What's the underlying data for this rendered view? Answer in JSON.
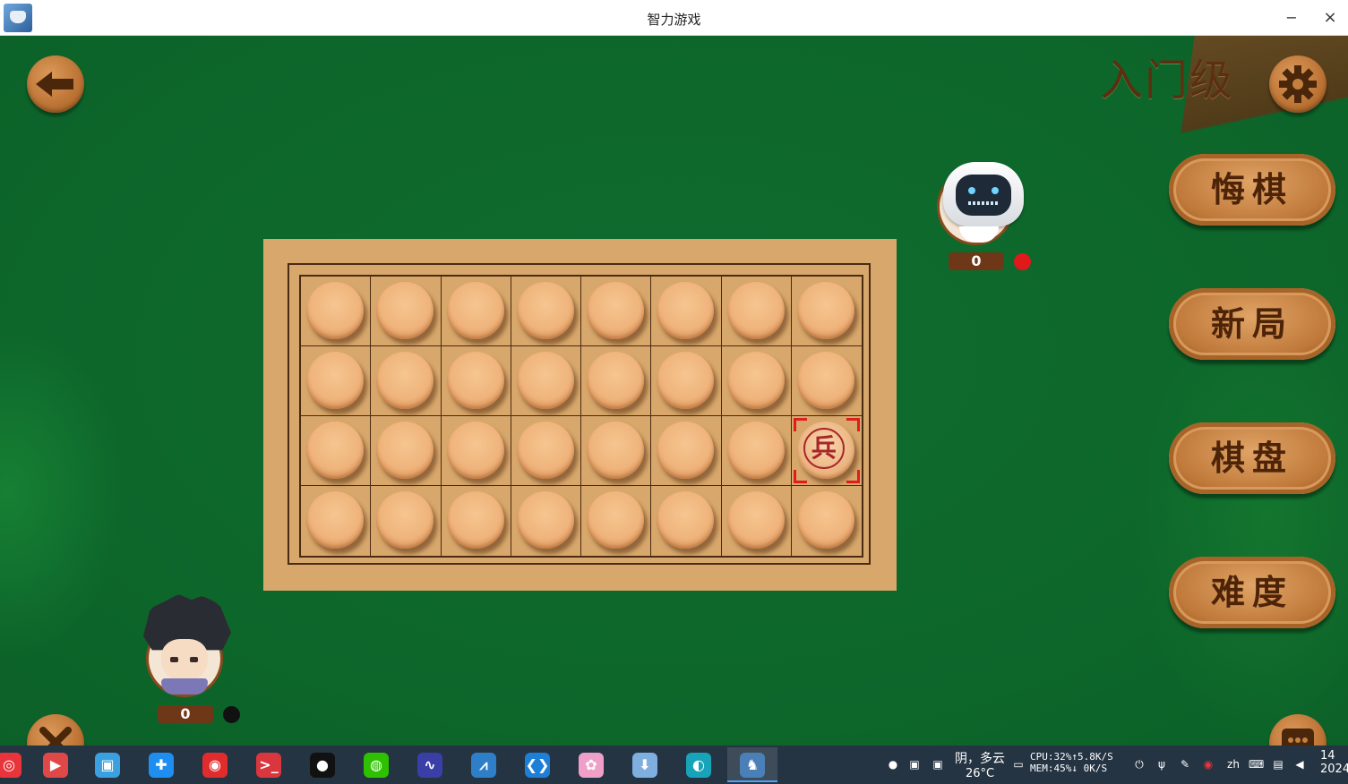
{
  "window": {
    "title": "智力游戏",
    "minimize_glyph": "−",
    "close_glyph": "×"
  },
  "game": {
    "level_label": "入门级",
    "back_icon": "arrow-left-icon",
    "settings_icon": "gear-icon",
    "close_icon": "close-icon",
    "chat_icon": "chat-icon",
    "side_buttons": [
      {
        "name": "undo-button",
        "label": "悔棋"
      },
      {
        "name": "new-game-button",
        "label": "新局"
      },
      {
        "name": "board-button",
        "label": "棋盘"
      },
      {
        "name": "difficulty-button",
        "label": "难度"
      }
    ],
    "opponent": {
      "role": "robot",
      "score": "0",
      "turn_color": "#e0191b"
    },
    "player": {
      "role": "boy",
      "score": "0",
      "turn_color": "#111111"
    },
    "board": {
      "rows": 4,
      "cols": 8,
      "revealed": [
        {
          "row": 2,
          "col": 7,
          "char": "兵",
          "color": "#a8262a",
          "selected": true
        }
      ]
    }
  },
  "taskbar": {
    "apps": [
      {
        "name": "netease-music-icon",
        "glyph": "◎",
        "color": "#e8343b"
      },
      {
        "name": "screen-recorder-icon",
        "glyph": "▶",
        "color": "#e04848"
      },
      {
        "name": "file-manager-icon",
        "glyph": "▣",
        "color": "#3ba0e0"
      },
      {
        "name": "todesk-icon",
        "glyph": "✚",
        "color": "#1f8ef1"
      },
      {
        "name": "netease-cloud-music-icon",
        "glyph": "◉",
        "color": "#e02c2c"
      },
      {
        "name": "terminal-icon",
        "glyph": ">_",
        "color": "#d9363e"
      },
      {
        "name": "qq-icon",
        "glyph": "●",
        "color": "#111111"
      },
      {
        "name": "wechat-icon",
        "glyph": "◍",
        "color": "#2dc100"
      },
      {
        "name": "system-monitor-icon",
        "glyph": "∿",
        "color": "#3a3fa8"
      },
      {
        "name": "monitor-chart-icon",
        "glyph": "⩘",
        "color": "#2f7fc8"
      },
      {
        "name": "vscode-icon",
        "glyph": "❮❯",
        "color": "#1e7fd8"
      },
      {
        "name": "image-viewer-icon",
        "glyph": "✿",
        "color": "#f0a0c8"
      },
      {
        "name": "app-store-icon",
        "glyph": "⬇",
        "color": "#7faee0"
      },
      {
        "name": "edge-browser-icon",
        "glyph": "◐",
        "color": "#18a4b8"
      },
      {
        "name": "puzzle-game-icon",
        "glyph": "♞",
        "color": "#4a7fb8"
      }
    ],
    "weather": {
      "condition": "阴，多云",
      "temperature": "26°C"
    },
    "stats": {
      "cpu": "CPU:32%",
      "upload": "↑5.8K/S",
      "mem": "MEM:45%",
      "download": "↓ 0K/S"
    },
    "language": "zh",
    "clock": {
      "time": "14",
      "date": "2024"
    }
  }
}
